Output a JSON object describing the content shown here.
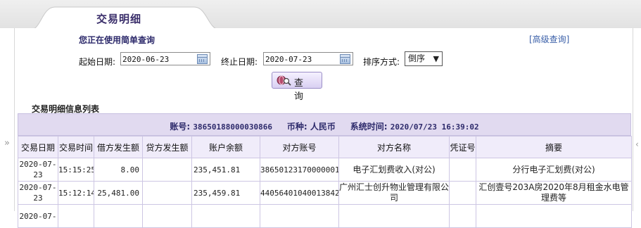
{
  "tab": {
    "label": "交易明细"
  },
  "notice": "您正在使用简单查询",
  "advanced_query": "[高级查询]",
  "form": {
    "start_label": "起始日期:",
    "start_value": "2020-06-23",
    "end_label": "终止日期:",
    "end_value": "2020-07-23",
    "sort_label": "排序方式:",
    "sort_value": "倒序",
    "query_button": "查 询"
  },
  "list_title": "交易明细信息列表",
  "info": {
    "account_label": "账号:",
    "account_value": "38650188000030866",
    "currency_label": "币种:",
    "currency_value": "人民币",
    "systime_label": "系统时间:",
    "systime_value": "2020/07/23 16:39:02"
  },
  "table": {
    "headers": [
      "交易日期",
      "交易时间",
      "借方发生额",
      "贷方发生额",
      "账户余额",
      "对方账号",
      "对方名称",
      "凭证号",
      "摘要"
    ],
    "rows": [
      [
        "2020-07-23",
        "15:15:25",
        "8.00",
        "",
        "235,451.81",
        "38650123170000001",
        "电子汇划费收入(对公)",
        "",
        "分行电子汇划费(对公)"
      ],
      [
        "2020-07-23",
        "15:12:14",
        "25,481.00",
        "",
        "235,459.81",
        "44056401040013842",
        "广州汇士创升物业管理有限公司",
        "",
        "汇创壹号203A房2020年8月租金水电管理费等"
      ],
      [
        "2020-07-",
        "",
        "",
        "",
        "",
        "",
        "",
        "",
        ""
      ]
    ]
  },
  "colors": {
    "accent": "#3b2f6b",
    "header_bg": "#e1daf0",
    "border": "#cdc6e3"
  },
  "icons": [
    "calendar-icon",
    "search-globe-icon",
    "chevron-down-icon",
    "collapse-arrow-icon"
  ]
}
